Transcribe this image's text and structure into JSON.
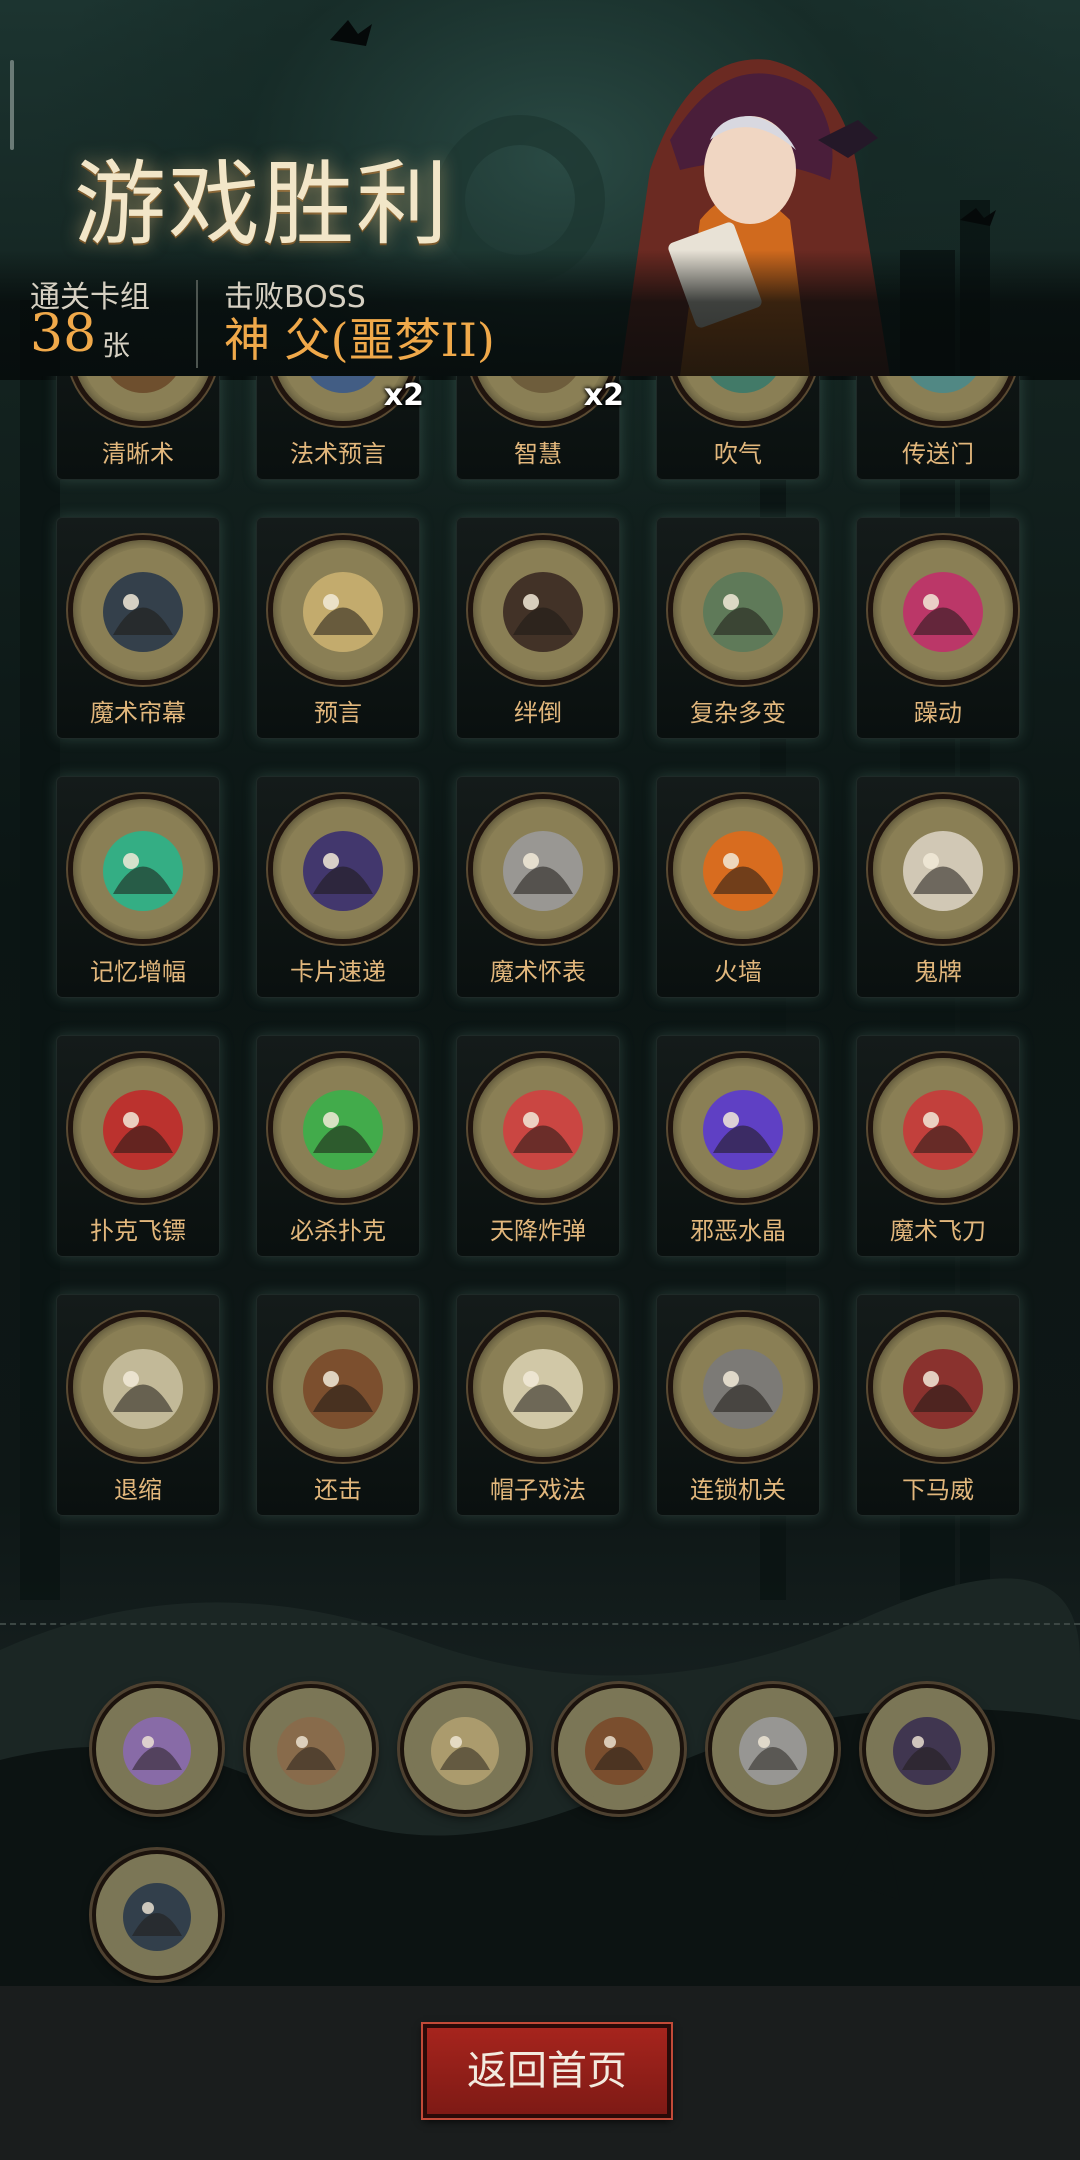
{
  "header": {
    "title": "游戏胜利",
    "deck_label": "通关卡组",
    "deck_count": "38",
    "deck_unit": "张",
    "boss_label": "击败BOSS",
    "boss_name": "神 父(噩梦II)"
  },
  "cards": [
    {
      "name": "清晰术",
      "icon": "cloaked-figure-icon",
      "color": "#6a4a2a"
    },
    {
      "name": "法术预言",
      "icon": "blue-orb-icon",
      "color": "#3a5a8a",
      "mult": "x2"
    },
    {
      "name": "智慧",
      "icon": "scroll-icon",
      "color": "#6a5a3a",
      "mult": "x2"
    },
    {
      "name": "吹气",
      "icon": "wind-icon",
      "color": "#3a7a6a"
    },
    {
      "name": "传送门",
      "icon": "portal-icon",
      "color": "#4a8a8a"
    },
    {
      "name": "魔术帘幕",
      "icon": "curtain-icon",
      "color": "#2a3a4a"
    },
    {
      "name": "预言",
      "icon": "sage-icon",
      "color": "#c9b070"
    },
    {
      "name": "绊倒",
      "icon": "boot-icon",
      "color": "#3a2a22"
    },
    {
      "name": "复杂多变",
      "icon": "tangle-icon",
      "color": "#5a7a5a"
    },
    {
      "name": "躁动",
      "icon": "frenzy-icon",
      "color": "#c0306a"
    },
    {
      "name": "记忆增幅",
      "icon": "brain-icon",
      "color": "#2ab48a"
    },
    {
      "name": "卡片速递",
      "icon": "flying-card-icon",
      "color": "#3a3070"
    },
    {
      "name": "魔术怀表",
      "icon": "pocket-watch-icon",
      "color": "#9a9a9a"
    },
    {
      "name": "火墙",
      "icon": "fire-wall-icon",
      "color": "#e06a1a"
    },
    {
      "name": "鬼牌",
      "icon": "skull-card-icon",
      "color": "#d8d0c0"
    },
    {
      "name": "扑克飞镖",
      "icon": "card-dart-icon",
      "color": "#c02a2a"
    },
    {
      "name": "必杀扑克",
      "icon": "killer-card-icon",
      "color": "#3ab04a"
    },
    {
      "name": "天降炸弹",
      "icon": "balloon-bomb-icon",
      "color": "#d04040"
    },
    {
      "name": "邪恶水晶",
      "icon": "crystal-icon",
      "color": "#5a3ad0"
    },
    {
      "name": "魔术飞刀",
      "icon": "clown-icon",
      "color": "#c83a3a"
    },
    {
      "name": "退缩",
      "icon": "retreat-icon",
      "color": "#c8c0a0"
    },
    {
      "name": "还击",
      "icon": "counter-attack-icon",
      "color": "#7a4a2a"
    },
    {
      "name": "帽子戏法",
      "icon": "rabbit-hat-icon",
      "color": "#d8d0b0"
    },
    {
      "name": "连锁机关",
      "icon": "trap-icon",
      "color": "#7a7a7a"
    },
    {
      "name": "下马威",
      "icon": "bear-strike-icon",
      "color": "#8a2a2a"
    }
  ],
  "relics": [
    {
      "icon": "octopus-relic-icon",
      "color": "#8a6ab0"
    },
    {
      "icon": "shackled-hands-relic-icon",
      "color": "#8a6a4a"
    },
    {
      "icon": "crossbow-relic-icon",
      "color": "#b0a070"
    },
    {
      "icon": "holy-book-relic-icon",
      "color": "#7a4a2a"
    },
    {
      "icon": "claw-relic-icon",
      "color": "#9a9a9a"
    },
    {
      "icon": "vampire-relic-icon",
      "color": "#3a3050"
    },
    {
      "icon": "hooded-card-master-relic-icon",
      "color": "#2a3a4a"
    }
  ],
  "bottom": {
    "home_button": "返回首页"
  },
  "colors": {
    "accent_orange": "#f0a94a",
    "card_name": "#e2b77c",
    "button_red": "#a6241d"
  }
}
